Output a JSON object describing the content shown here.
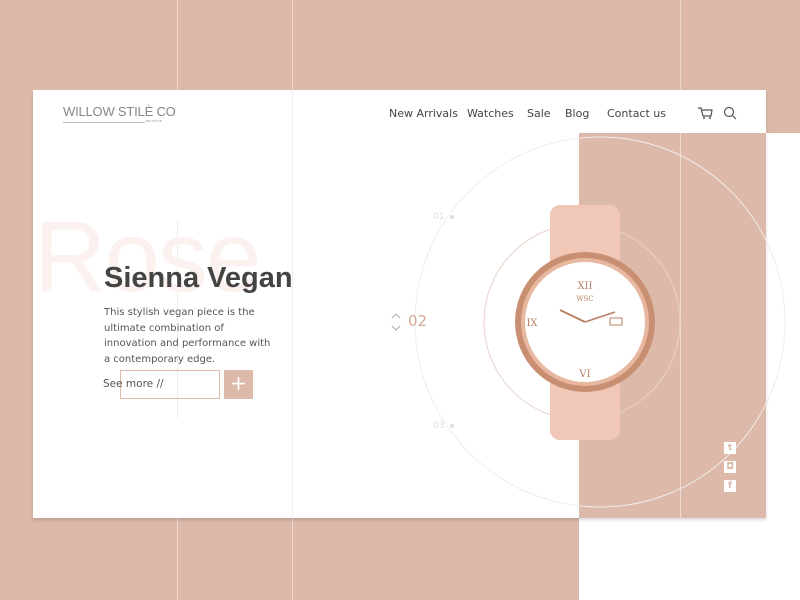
{
  "brand": {
    "name": "WILLOW STILÈ CO",
    "tagline": "BOUTIQUE"
  },
  "nav": {
    "items": [
      "New Arrivals",
      "Watches",
      "Sale",
      "Blog",
      "Contact us"
    ]
  },
  "icons": {
    "cart": "cart-icon",
    "search": "search-icon"
  },
  "hero": {
    "background_word": "Rose",
    "title": "Sienna Vegan",
    "description": "This stylish vegan piece is the ultimate combination of innovation and performance with a contemporary edge.",
    "see_more": "See more //",
    "plus": "+"
  },
  "slider": {
    "steps": [
      "01",
      "02",
      "03"
    ],
    "current": "02"
  },
  "watch": {
    "dial_text": "WSC"
  },
  "social": [
    "twitter",
    "instagram",
    "facebook"
  ],
  "colors": {
    "accent": "#dcb9a9",
    "text": "#444444"
  }
}
